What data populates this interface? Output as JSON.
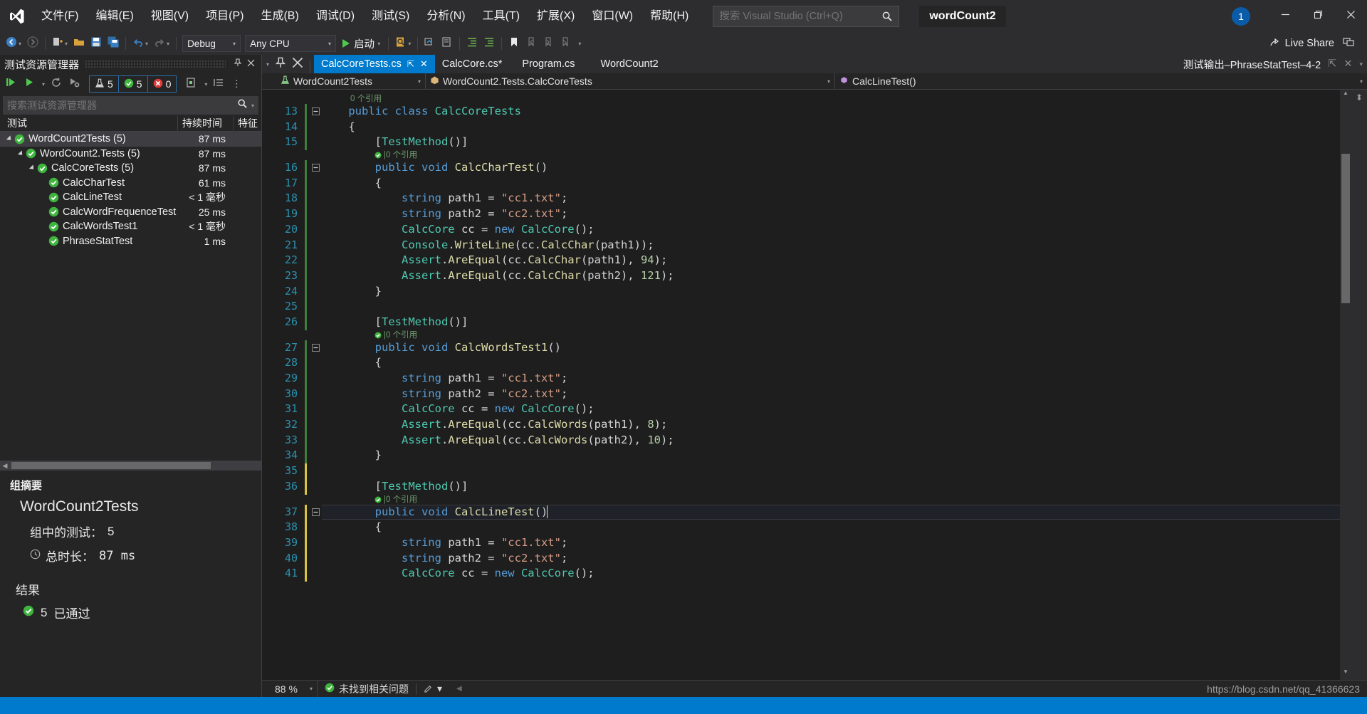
{
  "titlebar": {
    "logo_icon": "visual-studio-logo",
    "menus": [
      {
        "label": "文件(F)"
      },
      {
        "label": "编辑(E)"
      },
      {
        "label": "视图(V)"
      },
      {
        "label": "项目(P)"
      },
      {
        "label": "生成(B)"
      },
      {
        "label": "调试(D)"
      },
      {
        "label": "测试(S)"
      },
      {
        "label": "分析(N)"
      },
      {
        "label": "工具(T)"
      },
      {
        "label": "扩展(X)"
      },
      {
        "label": "窗口(W)"
      },
      {
        "label": "帮助(H)"
      }
    ],
    "search_placeholder": "搜索 Visual Studio (Ctrl+Q)",
    "search_value": "",
    "search_icon": "search-icon",
    "solution_name": "wordCount2",
    "notification_count": "1",
    "minimize_icon": "minimize-icon",
    "restore_icon": "restore-icon",
    "close_icon": "close-icon"
  },
  "toolbar": {
    "back_icon": "navigate-back-icon",
    "forward_icon": "navigate-forward-icon",
    "new_project_icon": "new-project-icon",
    "open_icon": "open-file-icon",
    "save_icon": "save-icon",
    "save_all_icon": "save-all-icon",
    "undo_icon": "undo-icon",
    "redo_icon": "redo-icon",
    "configuration": "Debug",
    "platform": "Any CPU",
    "start_label": "启动",
    "start_icon": "play-icon",
    "find_icon": "find-in-files-icon",
    "comment_icon": "comment-icon",
    "uncomment_icon": "uncomment-icon",
    "indent_icon": "increase-indent-icon",
    "outdent_icon": "decrease-indent-icon",
    "bookmark_icon": "bookmark-icon",
    "prev_bookmark_icon": "previous-bookmark-icon",
    "next_bookmark_icon": "next-bookmark-icon",
    "clear_bookmark_icon": "clear-bookmarks-icon",
    "overflow_icon": "toolbar-overflow-icon",
    "live_share_label": "Live Share",
    "live_share_icon": "live-share-icon",
    "feedback_icon": "send-feedback-icon"
  },
  "test_explorer": {
    "title": "测试资源管理器",
    "pin_icon": "pin-icon",
    "close_icon": "close-icon",
    "run_all_icon": "run-all-tests-icon",
    "run_icon": "run-tests-icon",
    "run_dropdown_icon": "chevron-down-icon",
    "repeat_icon": "repeat-last-run-icon",
    "cancel_icon": "cancel-run-icon",
    "counters": {
      "total_icon": "beaker-icon",
      "total": "5",
      "passed_icon": "passed-check-icon",
      "passed": "5",
      "failed_icon": "failed-x-icon",
      "failed": "0"
    },
    "playlist_icon": "playlist-icon",
    "group_icon": "group-by-icon",
    "search_placeholder": "搜索测试资源管理器",
    "search_value": "",
    "search_icon": "search-icon",
    "columns": {
      "test": "测试",
      "duration": "持续时间",
      "traits": "特征"
    },
    "rows": [
      {
        "label": "WordCount2Tests (5)",
        "duration": "87 ms",
        "depth": 0,
        "expandable": true,
        "status": "passed",
        "selected": true
      },
      {
        "label": "WordCount2.Tests (5)",
        "duration": "87 ms",
        "depth": 1,
        "expandable": true,
        "status": "passed",
        "selected": false
      },
      {
        "label": "CalcCoreTests (5)",
        "duration": "87 ms",
        "depth": 2,
        "expandable": true,
        "status": "passed",
        "selected": false
      },
      {
        "label": "CalcCharTest",
        "duration": "61 ms",
        "depth": 3,
        "expandable": false,
        "status": "passed",
        "selected": false
      },
      {
        "label": "CalcLineTest",
        "duration": "< 1 毫秒",
        "depth": 3,
        "expandable": false,
        "status": "passed",
        "selected": false
      },
      {
        "label": "CalcWordFrequenceTest",
        "duration": "25 ms",
        "depth": 3,
        "expandable": false,
        "status": "passed",
        "selected": false
      },
      {
        "label": "CalcWordsTest1",
        "duration": "< 1 毫秒",
        "depth": 3,
        "expandable": false,
        "status": "passed",
        "selected": false
      },
      {
        "label": "PhraseStatTest",
        "duration": "1 ms",
        "depth": 3,
        "expandable": false,
        "status": "passed",
        "selected": false
      }
    ],
    "summary": {
      "heading": "组摘要",
      "group_name": "WordCount2Tests",
      "tests_in_group_label": "组中的测试：",
      "tests_in_group_value": "5",
      "duration_label": "总时长：",
      "duration_value": "87 ms",
      "clock_icon": "clock-icon",
      "results_heading": "结果",
      "passed_icon": "passed-check-icon",
      "passed_count": "5",
      "passed_label": "已通过"
    }
  },
  "editor": {
    "tabs": [
      {
        "label": "CalcCoreTests.cs",
        "active": true,
        "pinnable": true,
        "closable": true
      },
      {
        "label": "CalcCore.cs*",
        "active": false,
        "pinnable": false,
        "closable": false
      },
      {
        "label": "Program.cs",
        "active": false,
        "pinnable": false,
        "closable": false
      },
      {
        "label": "WordCount2",
        "active": false,
        "pinnable": false,
        "closable": false
      }
    ],
    "right_tab": "测试输出–PhraseStatTest–4-2",
    "right_pin_icon": "pin-icon",
    "right_close_icon": "close-icon",
    "right_chevron_icon": "chevron-down-icon",
    "navbar": {
      "project": "WordCount2Tests",
      "project_icon": "test-project-icon",
      "type": "WordCount2.Tests.CalcCoreTests",
      "type_icon": "class-icon",
      "member": "CalcLineTest()",
      "member_icon": "method-icon",
      "caret_icon": "chevron-down-icon"
    },
    "first_line_number": 13,
    "lines": [
      {
        "n": 13,
        "fragments": [
          {
            "t": "public ",
            "c": "k"
          },
          {
            "t": "class ",
            "c": "k"
          },
          {
            "t": "CalcCoreTests",
            "c": "kc"
          }
        ],
        "indent": 4,
        "collapsible": true,
        "changed": false
      },
      {
        "n": 14,
        "fragments": [
          {
            "t": "{",
            "c": "p"
          }
        ],
        "indent": 4,
        "collapsible": false,
        "changed": false
      },
      {
        "n": 15,
        "fragments": [
          {
            "t": "[",
            "c": "p"
          },
          {
            "t": "TestMethod",
            "c": "at"
          },
          {
            "t": "()]",
            "c": "p"
          }
        ],
        "indent": 8,
        "collapsible": false,
        "changed": false
      },
      {
        "n": 16,
        "fragments": [
          {
            "t": "public ",
            "c": "k"
          },
          {
            "t": "void ",
            "c": "k"
          },
          {
            "t": "CalcCharTest",
            "c": "m"
          },
          {
            "t": "()",
            "c": "p"
          }
        ],
        "indent": 8,
        "collapsible": true,
        "changed": false
      },
      {
        "n": 17,
        "fragments": [
          {
            "t": "{",
            "c": "p"
          }
        ],
        "indent": 8,
        "collapsible": false,
        "changed": false
      },
      {
        "n": 18,
        "fragments": [
          {
            "t": "string ",
            "c": "k"
          },
          {
            "t": "path1 = ",
            "c": "p"
          },
          {
            "t": "\"cc1.txt\"",
            "c": "s"
          },
          {
            "t": ";",
            "c": "p"
          }
        ],
        "indent": 12,
        "collapsible": false,
        "changed": false
      },
      {
        "n": 19,
        "fragments": [
          {
            "t": "string ",
            "c": "k"
          },
          {
            "t": "path2 = ",
            "c": "p"
          },
          {
            "t": "\"cc2.txt\"",
            "c": "s"
          },
          {
            "t": ";",
            "c": "p"
          }
        ],
        "indent": 12,
        "collapsible": false,
        "changed": false
      },
      {
        "n": 20,
        "fragments": [
          {
            "t": "CalcCore",
            "c": "kc"
          },
          {
            "t": " cc = ",
            "c": "p"
          },
          {
            "t": "new ",
            "c": "k"
          },
          {
            "t": "CalcCore",
            "c": "kc"
          },
          {
            "t": "();",
            "c": "p"
          }
        ],
        "indent": 12,
        "collapsible": false,
        "changed": false
      },
      {
        "n": 21,
        "fragments": [
          {
            "t": "Console",
            "c": "kc"
          },
          {
            "t": ".",
            "c": "p"
          },
          {
            "t": "WriteLine",
            "c": "m"
          },
          {
            "t": "(cc.",
            "c": "p"
          },
          {
            "t": "CalcChar",
            "c": "m"
          },
          {
            "t": "(path1));",
            "c": "p"
          }
        ],
        "indent": 12,
        "collapsible": false,
        "changed": false
      },
      {
        "n": 22,
        "fragments": [
          {
            "t": "Assert",
            "c": "kc"
          },
          {
            "t": ".",
            "c": "p"
          },
          {
            "t": "AreEqual",
            "c": "m"
          },
          {
            "t": "(cc.",
            "c": "p"
          },
          {
            "t": "CalcChar",
            "c": "m"
          },
          {
            "t": "(path1), ",
            "c": "p"
          },
          {
            "t": "94",
            "c": "n"
          },
          {
            "t": ");",
            "c": "p"
          }
        ],
        "indent": 12,
        "collapsible": false,
        "changed": false
      },
      {
        "n": 23,
        "fragments": [
          {
            "t": "Assert",
            "c": "kc"
          },
          {
            "t": ".",
            "c": "p"
          },
          {
            "t": "AreEqual",
            "c": "m"
          },
          {
            "t": "(cc.",
            "c": "p"
          },
          {
            "t": "CalcChar",
            "c": "m"
          },
          {
            "t": "(path2), ",
            "c": "p"
          },
          {
            "t": "121",
            "c": "n"
          },
          {
            "t": ");",
            "c": "p"
          }
        ],
        "indent": 12,
        "collapsible": false,
        "changed": false
      },
      {
        "n": 24,
        "fragments": [
          {
            "t": "}",
            "c": "p"
          }
        ],
        "indent": 8,
        "collapsible": false,
        "changed": false
      },
      {
        "n": 25,
        "fragments": [],
        "indent": 0,
        "collapsible": false,
        "changed": false
      },
      {
        "n": 26,
        "fragments": [
          {
            "t": "[",
            "c": "p"
          },
          {
            "t": "TestMethod",
            "c": "at"
          },
          {
            "t": "()]",
            "c": "p"
          }
        ],
        "indent": 8,
        "collapsible": false,
        "changed": false
      },
      {
        "n": 27,
        "fragments": [
          {
            "t": "public ",
            "c": "k"
          },
          {
            "t": "void ",
            "c": "k"
          },
          {
            "t": "CalcWordsTest1",
            "c": "m"
          },
          {
            "t": "()",
            "c": "p"
          }
        ],
        "indent": 8,
        "collapsible": true,
        "changed": false
      },
      {
        "n": 28,
        "fragments": [
          {
            "t": "{",
            "c": "p"
          }
        ],
        "indent": 8,
        "collapsible": false,
        "changed": false
      },
      {
        "n": 29,
        "fragments": [
          {
            "t": "string ",
            "c": "k"
          },
          {
            "t": "path1 = ",
            "c": "p"
          },
          {
            "t": "\"cc1.txt\"",
            "c": "s"
          },
          {
            "t": ";",
            "c": "p"
          }
        ],
        "indent": 12,
        "collapsible": false,
        "changed": false
      },
      {
        "n": 30,
        "fragments": [
          {
            "t": "string ",
            "c": "k"
          },
          {
            "t": "path2 = ",
            "c": "p"
          },
          {
            "t": "\"cc2.txt\"",
            "c": "s"
          },
          {
            "t": ";",
            "c": "p"
          }
        ],
        "indent": 12,
        "collapsible": false,
        "changed": false
      },
      {
        "n": 31,
        "fragments": [
          {
            "t": "CalcCore",
            "c": "kc"
          },
          {
            "t": " cc = ",
            "c": "p"
          },
          {
            "t": "new ",
            "c": "k"
          },
          {
            "t": "CalcCore",
            "c": "kc"
          },
          {
            "t": "();",
            "c": "p"
          }
        ],
        "indent": 12,
        "collapsible": false,
        "changed": false
      },
      {
        "n": 32,
        "fragments": [
          {
            "t": "Assert",
            "c": "kc"
          },
          {
            "t": ".",
            "c": "p"
          },
          {
            "t": "AreEqual",
            "c": "m"
          },
          {
            "t": "(cc.",
            "c": "p"
          },
          {
            "t": "CalcWords",
            "c": "m"
          },
          {
            "t": "(path1), ",
            "c": "p"
          },
          {
            "t": "8",
            "c": "n"
          },
          {
            "t": ");",
            "c": "p"
          }
        ],
        "indent": 12,
        "collapsible": false,
        "changed": false
      },
      {
        "n": 33,
        "fragments": [
          {
            "t": "Assert",
            "c": "kc"
          },
          {
            "t": ".",
            "c": "p"
          },
          {
            "t": "AreEqual",
            "c": "m"
          },
          {
            "t": "(cc.",
            "c": "p"
          },
          {
            "t": "CalcWords",
            "c": "m"
          },
          {
            "t": "(path2), ",
            "c": "p"
          },
          {
            "t": "10",
            "c": "n"
          },
          {
            "t": ");",
            "c": "p"
          }
        ],
        "indent": 12,
        "collapsible": false,
        "changed": false
      },
      {
        "n": 34,
        "fragments": [
          {
            "t": "}",
            "c": "p"
          }
        ],
        "indent": 8,
        "collapsible": false,
        "changed": false
      },
      {
        "n": 35,
        "fragments": [],
        "indent": 0,
        "collapsible": false,
        "changed": true
      },
      {
        "n": 36,
        "fragments": [
          {
            "t": "[",
            "c": "p"
          },
          {
            "t": "TestMethod",
            "c": "at"
          },
          {
            "t": "()]",
            "c": "p"
          }
        ],
        "indent": 8,
        "collapsible": false,
        "changed": true
      },
      {
        "n": 37,
        "fragments": [
          {
            "t": "public ",
            "c": "k"
          },
          {
            "t": "void ",
            "c": "k"
          },
          {
            "t": "CalcLineTest",
            "c": "m"
          },
          {
            "t": "()",
            "c": "p"
          }
        ],
        "indent": 8,
        "collapsible": true,
        "changed": true,
        "highlight": true
      },
      {
        "n": 38,
        "fragments": [
          {
            "t": "{",
            "c": "p"
          }
        ],
        "indent": 8,
        "collapsible": false,
        "changed": true
      },
      {
        "n": 39,
        "fragments": [
          {
            "t": "string ",
            "c": "k"
          },
          {
            "t": "path1 = ",
            "c": "p"
          },
          {
            "t": "\"cc1.txt\"",
            "c": "s"
          },
          {
            "t": ";",
            "c": "p"
          }
        ],
        "indent": 12,
        "collapsible": false,
        "changed": true
      },
      {
        "n": 40,
        "fragments": [
          {
            "t": "string ",
            "c": "k"
          },
          {
            "t": "path2 = ",
            "c": "p"
          },
          {
            "t": "\"cc2.txt\"",
            "c": "s"
          },
          {
            "t": ";",
            "c": "p"
          }
        ],
        "indent": 12,
        "collapsible": false,
        "changed": true
      },
      {
        "n": 41,
        "fragments": [
          {
            "t": "CalcCore",
            "c": "kc"
          },
          {
            "t": " cc = ",
            "c": "p"
          },
          {
            "t": "new ",
            "c": "k"
          },
          {
            "t": "CalcCore",
            "c": "kc"
          },
          {
            "t": "();",
            "c": "p"
          }
        ],
        "indent": 12,
        "collapsible": false,
        "changed": true
      }
    ],
    "codelens": [
      {
        "after_line": 12,
        "text": "0 个引用",
        "indent": 4,
        "has_icon": false
      },
      {
        "after_line": 15,
        "text": "0 个引用",
        "indent": 8,
        "has_icon": true
      },
      {
        "after_line": 26,
        "text": "0 个引用",
        "indent": 8,
        "has_icon": true
      },
      {
        "after_line": 36,
        "text": "0 个引用",
        "indent": 8,
        "has_icon": true
      }
    ]
  },
  "statusbar": {
    "zoom": "88 %",
    "zoom_caret_icon": "chevron-down-icon",
    "issues_icon": "no-issues-check-icon",
    "issues_text": "未找到相关问题",
    "pen_icon": "edit-pen-icon",
    "pen_caret_icon": "chevron-down-icon",
    "scroll_icon": "scroll-left-icon",
    "watermark": "https://blog.csdn.net/qq_41366623"
  },
  "colors": {
    "accent": "#007acc",
    "chrome": "#2d2d30",
    "panel": "#252526",
    "editor_bg": "#1e1e1e",
    "pass_green": "#4ec94e",
    "fail_red": "#e81123",
    "line_number": "#2b91af",
    "keyword": "#569cd6",
    "type": "#4ec9b0",
    "string": "#d69d85",
    "number": "#b5cea8",
    "method": "#dcdcaa"
  }
}
